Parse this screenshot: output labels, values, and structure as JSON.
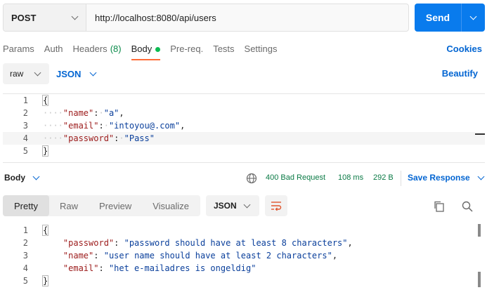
{
  "request": {
    "method": "POST",
    "url": "http://localhost:8080/api/users",
    "send_label": "Send"
  },
  "tabs": [
    {
      "label": "Params"
    },
    {
      "label": "Auth"
    },
    {
      "label": "Headers",
      "count": "(8)"
    },
    {
      "label": "Body",
      "active": true
    },
    {
      "label": "Pre-req."
    },
    {
      "label": "Tests"
    },
    {
      "label": "Settings"
    }
  ],
  "cookies_label": "Cookies",
  "body_options": {
    "mode": "raw",
    "language": "JSON",
    "beautify_label": "Beautify"
  },
  "request_body": {
    "line_numbers": [
      "1",
      "2",
      "3",
      "4",
      "5"
    ],
    "lines": [
      {
        "text": "{"
      },
      {
        "key": "\"name\"",
        "value": "\"a\"",
        "trail": ","
      },
      {
        "key": "\"email\"",
        "value": "\"intoyou@.com\"",
        "trail": ","
      },
      {
        "key": "\"password\"",
        "value": "\"Pass\"",
        "trail": ""
      },
      {
        "text": "}"
      }
    ]
  },
  "response": {
    "section_label": "Body",
    "status": "400 Bad Request",
    "time": "108 ms",
    "size": "292 B",
    "save_label": "Save Response",
    "view_tabs": [
      "Pretty",
      "Raw",
      "Preview",
      "Visualize"
    ],
    "active_view": "Pretty",
    "format": "JSON",
    "line_numbers": [
      "1",
      "2",
      "3",
      "4",
      "5"
    ],
    "lines": [
      {
        "text": "{"
      },
      {
        "key": "\"password\"",
        "value": "\"password should have at least 8 characters\"",
        "trail": ","
      },
      {
        "key": "\"name\"",
        "value": "\"user name should have at least 2 characters\"",
        "trail": ","
      },
      {
        "key": "\"email\"",
        "value": "\"het e-mailadres is ongeldig\"",
        "trail": ""
      },
      {
        "text": "}"
      }
    ]
  },
  "colors": {
    "accent": "#097bed",
    "link": "#0265d2",
    "active_tab_underline": "#ff6c37",
    "status_green": "#0a7a45",
    "json_key": "#9c1b1b",
    "json_string": "#0a3f9b"
  },
  "icons": {
    "globe": "globe-icon",
    "wrap": "wrap-lines-icon",
    "copy": "copy-icon",
    "search": "search-icon"
  }
}
